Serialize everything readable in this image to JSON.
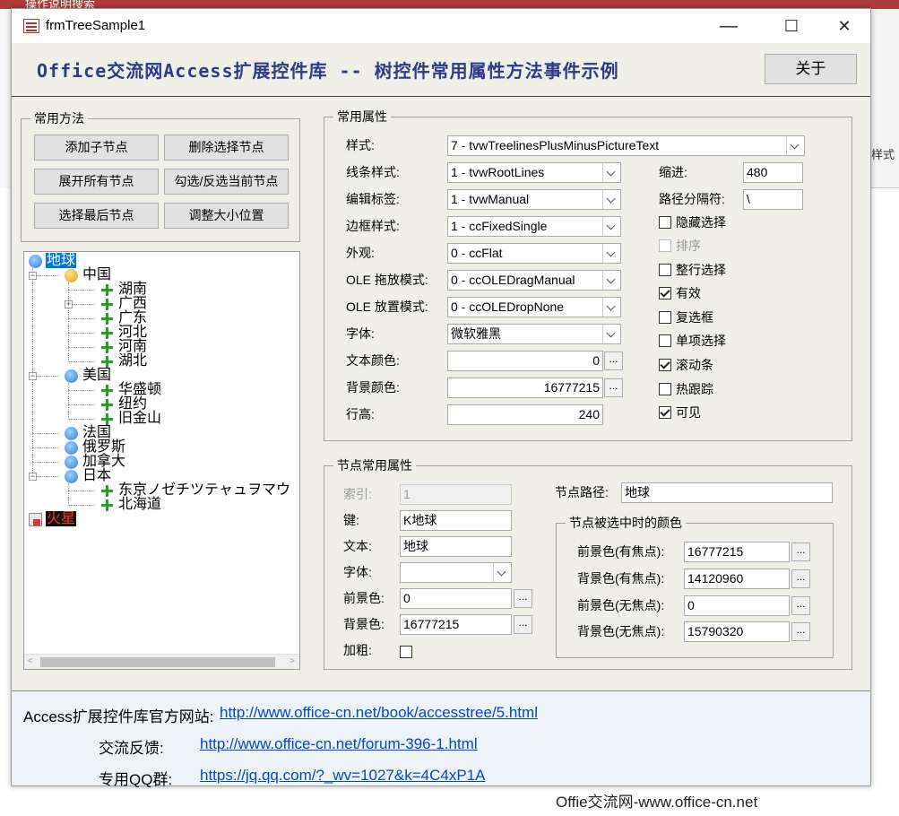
{
  "background": {
    "strip_text": "操作说明搜索",
    "ribbon_text": "样式",
    "watermark": "Offie交流网-www.office-cn.net"
  },
  "window": {
    "title": "frmTreeSample1",
    "minimize": "—",
    "maximize": "☐",
    "close": "✕"
  },
  "header": {
    "title": "Office交流网Access扩展控件库 -- 树控件常用属性方法事件示例",
    "about": "关于"
  },
  "methods": {
    "legend": "常用方法",
    "buttons": [
      "添加子节点",
      "删除选择节点",
      "展开所有节点",
      "勾选/反选当前节点",
      "选择最后节点",
      "调整大小位置"
    ]
  },
  "tree": {
    "nodes": [
      "地球",
      "中国",
      "湖南",
      "广西",
      "广东",
      "河北",
      "河南",
      "湖北",
      "美国",
      "华盛顿",
      "纽约",
      "旧金山",
      "法国",
      "俄罗斯",
      "加拿大",
      "日本",
      "东京ノゼチツテャュヲマウ",
      "北海道",
      "火星"
    ]
  },
  "props": {
    "legend": "常用属性",
    "style_label": "样式:",
    "style_value": "7 - tvwTreelinesPlusMinusPictureText",
    "line_label": "线条样式:",
    "line_value": "1 - tvwRootLines",
    "edit_label": "编辑标签:",
    "edit_value": "1 - tvwManual",
    "border_label": "边框样式:",
    "border_value": "1 - ccFixedSingle",
    "appear_label": "外观:",
    "appear_value": "0 - ccFlat",
    "oledrag_label": "OLE 拖放模式:",
    "oledrag_value": "0 - ccOLEDragManual",
    "oledrop_label": "OLE 放置模式:",
    "oledrop_value": "0 - ccOLEDropNone",
    "font_label": "字体:",
    "font_value": "微软雅黑",
    "forecolor_label": "文本颜色:",
    "forecolor_value": "0",
    "backcolor_label": "背景颜色:",
    "backcolor_value": "16777215",
    "rowheight_label": "行高:",
    "rowheight_value": "240",
    "indent_label": "缩进:",
    "indent_value": "480",
    "pathsep_label": "路径分隔符:",
    "pathsep_value": "\\",
    "checks": [
      {
        "label": "隐藏选择",
        "checked": false
      },
      {
        "label": "排序",
        "checked": false
      },
      {
        "label": "整行选择",
        "checked": false
      },
      {
        "label": "有效",
        "checked": true
      },
      {
        "label": "复选框",
        "checked": false
      },
      {
        "label": "单项选择",
        "checked": false
      },
      {
        "label": "滚动条",
        "checked": true
      },
      {
        "label": "热跟踪",
        "checked": false
      },
      {
        "label": "可见",
        "checked": true
      }
    ],
    "ellipsis": "..."
  },
  "node": {
    "legend": "节点常用属性",
    "index_label": "索引:",
    "index_value": "1",
    "key_label": "键:",
    "key_value": "K地球",
    "text_label": "文本:",
    "text_value": "地球",
    "font_label": "字体:",
    "font_value": "",
    "fore_label": "前景色:",
    "fore_value": "0",
    "back_label": "背景色:",
    "back_value": "16777215",
    "bold_label": "加粗:",
    "path_label": "节点路径:",
    "path_value": "地球",
    "sel_legend": "节点被选中时的颜色",
    "sel_fore_focus_label": "前景色(有焦点):",
    "sel_fore_focus_value": "16777215",
    "sel_back_focus_label": "背景色(有焦点):",
    "sel_back_focus_value": "14120960",
    "sel_fore_nofocus_label": "前景色(无焦点):",
    "sel_fore_nofocus_value": "0",
    "sel_back_nofocus_label": "背景色(无焦点):",
    "sel_back_nofocus_value": "15790320"
  },
  "footer": {
    "site_label": "Access扩展控件库官方网站:",
    "site_link": "http://www.office-cn.net/book/accesstree/5.html",
    "feedback_label": "交流反馈:",
    "feedback_link": "http://www.office-cn.net/forum-396-1.html",
    "qq_label": "专用QQ群:",
    "qq_link": "https://jq.qq.com/?_wv=1027&k=4C4xP1A"
  }
}
